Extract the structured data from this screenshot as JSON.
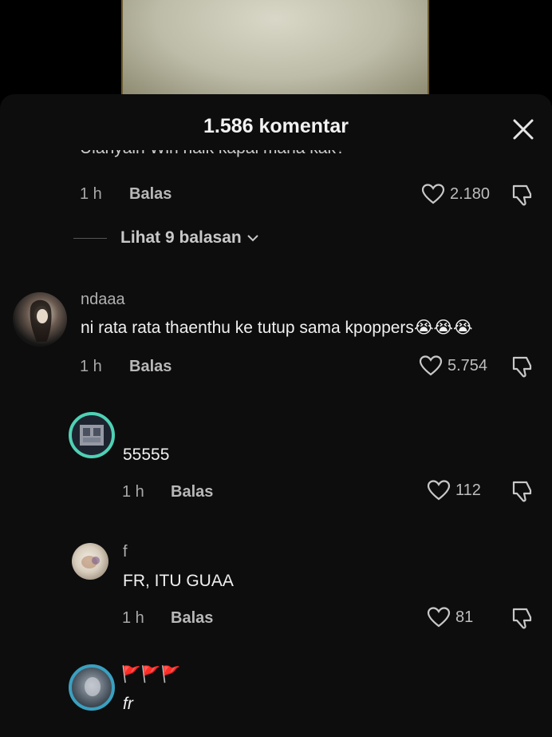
{
  "sheet": {
    "title": "1.586 komentar"
  },
  "partial_comment": {
    "text": "Ulanyain Win naik kapal mana kak?",
    "time": "1 h",
    "reply_label": "Balas",
    "likes": "2.180"
  },
  "view_replies": {
    "label": "Lihat 9 balasan"
  },
  "comments": [
    {
      "username": "ndaaa",
      "text": "ni rata rata thaenthu ke tutup sama kpoppers",
      "emoji": "😭😭😭",
      "time": "1 h",
      "reply_label": "Balas",
      "likes": "5.754"
    },
    {
      "username": "",
      "text": "55555",
      "time": "1 h",
      "reply_label": "Balas",
      "likes": "112"
    },
    {
      "username": "f",
      "text": "FR, ITU GUAA",
      "time": "1 h",
      "reply_label": "Balas",
      "likes": "81"
    },
    {
      "username": "🚩🚩🚩",
      "text": "fr"
    }
  ],
  "colors": {
    "background": "#000000",
    "sheet": "#0d0d0d",
    "flag_red": "#e0242c"
  }
}
